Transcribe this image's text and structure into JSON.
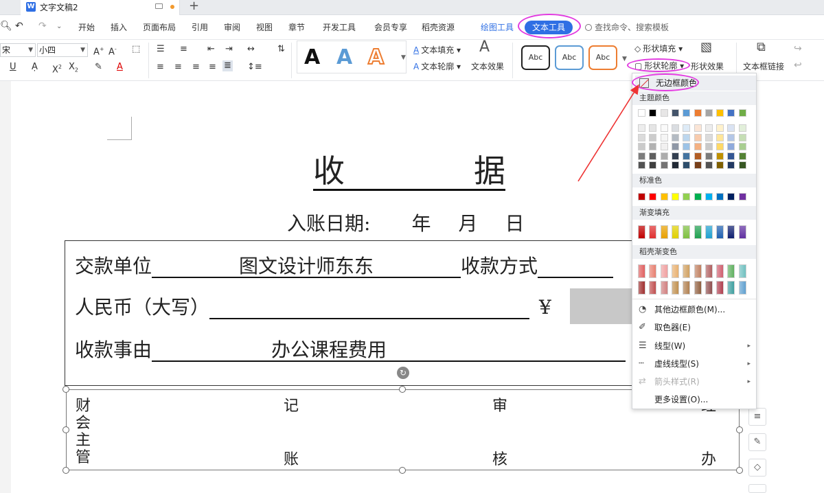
{
  "titlebar": {
    "doc_name": "文字文稿2",
    "new_tab": "+"
  },
  "menu": {
    "items": [
      "开始",
      "插入",
      "页面布局",
      "引用",
      "审阅",
      "视图",
      "章节",
      "开发工具",
      "会员专享",
      "稻壳资源"
    ],
    "drawing_tool": "绘图工具",
    "text_tool": "文本工具",
    "search_placeholder": "查找命令、搜索模板"
  },
  "toolbar": {
    "font_name": "宋",
    "font_size": "小四",
    "wordart_letter": "A",
    "text_fill": "文本填充",
    "text_outline": "文本轮廓",
    "text_effect": "文本效果",
    "style_sample": "Abc",
    "shape_fill": "形状填充",
    "shape_outline": "形状轮廓",
    "shape_effect": "形状效果",
    "textbox_link": "文本框链接"
  },
  "document": {
    "title_left": "收",
    "title_right": "据",
    "entry_date": {
      "label": "入账日期:",
      "year": "年",
      "month": "月",
      "day": "日"
    },
    "rows": {
      "payer_label": "交款单位",
      "payer_value": "图文设计师东东",
      "pay_method_label": "收款方式",
      "rmb_label": "人民币（大写）",
      "yen": "¥",
      "reason_label": "收款事由",
      "reason_value": "办公课程费用"
    },
    "signatures": {
      "finance_supervisor": [
        "财",
        "会",
        "主",
        "管"
      ],
      "bookkeeping": [
        "记",
        "账"
      ],
      "audit": [
        "审",
        "核"
      ],
      "handler": [
        "经",
        "办"
      ]
    }
  },
  "dropdown": {
    "no_border": "无边框颜色",
    "theme_colors": "主题颜色",
    "standard_colors": "标准色",
    "gradient_fill": "渐变填充",
    "docer_gradient": "稻壳渐变色",
    "more_colors": "其他边框颜色(M)...",
    "eyedropper": "取色器(E)",
    "line_type": "线型(W)",
    "dash_type": "虚线线型(S)",
    "arrow_style": "箭头样式(R)",
    "more_settings": "更多设置(O)...",
    "theme_top": [
      "#ffffff",
      "#000000",
      "#e7e6e6",
      "#44546a",
      "#5b9bd5",
      "#ed7d31",
      "#a5a5a5",
      "#ffc000",
      "#4472c4",
      "#70ad47"
    ],
    "standard": [
      "#c00000",
      "#ff0000",
      "#ffc000",
      "#ffff00",
      "#92d050",
      "#00b050",
      "#00b0f0",
      "#0070c0",
      "#002060",
      "#7030a0"
    ],
    "gradient": [
      "#c00000",
      "#e03030",
      "#e8a000",
      "#e0d000",
      "#7fc040",
      "#20a050",
      "#20a0d0",
      "#2060b0",
      "#102070",
      "#6030a0"
    ],
    "docer_row1": [
      "#e06060",
      "#e88070",
      "#f0a0a0",
      "#e8b070",
      "#d0a060",
      "#c08060",
      "#b06060",
      "#d06070",
      "#60b060",
      "#70c0c0"
    ],
    "docer_row2": [
      "#a03030",
      "#c05050",
      "#d08080",
      "#c09050",
      "#b08050",
      "#906040",
      "#905050",
      "#b04050",
      "#40a0a0",
      "#60a0d0"
    ]
  }
}
